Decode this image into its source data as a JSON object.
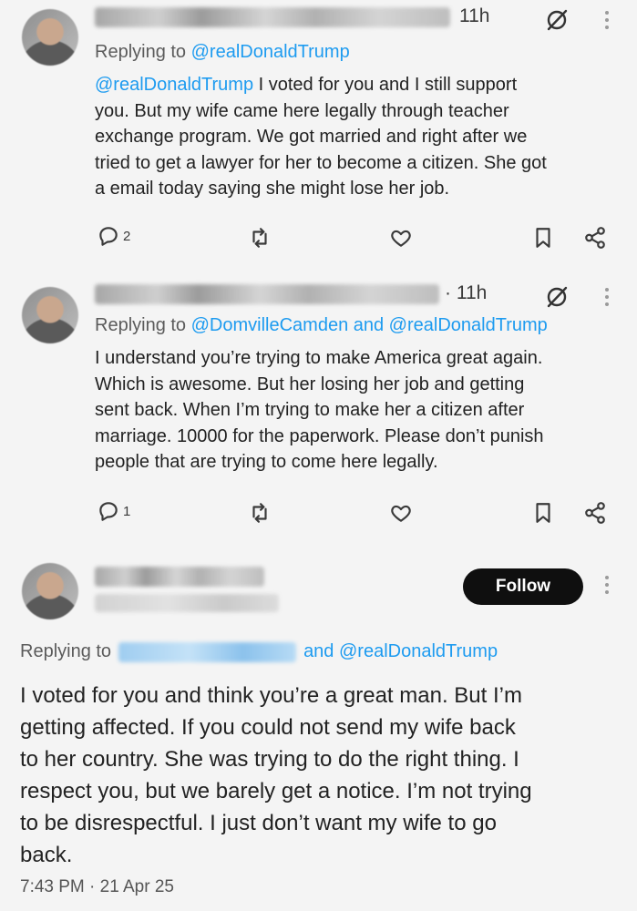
{
  "tweets": [
    {
      "time": "11h",
      "reply_prefix": "Replying to",
      "reply_mentions": "@realDonaldTrump",
      "body_mention": "@realDonaldTrump",
      "lines": [
        " I voted for you and I still support",
        "you. But my wife came here legally through teacher",
        "exchange program. We got married and right after we",
        "tried to get a lawyer for her to become a citizen. She got",
        "a email today saying she might lose her job."
      ],
      "reply_count": "2"
    },
    {
      "time": "· 11h",
      "reply_prefix": "Replying to",
      "reply_mentions": "@DomvilleCamden and @realDonaldTrump",
      "lines": [
        "I understand you’re trying to make America great again.",
        "Which is awesome. But her losing her job and getting",
        "sent back. When I’m trying to make her a citizen after",
        "marriage. 10000 for the paperwork. Please don’t punish",
        "people that are trying to come here legally."
      ],
      "reply_count": "1"
    }
  ],
  "main_tweet": {
    "follow_label": "Follow",
    "reply_prefix": "Replying to",
    "reply_suffix": "and @realDonaldTrump",
    "lines": [
      "I voted for you and think you’re a great man. But I’m",
      "getting affected. If you could not send my wife back",
      "to her country. She was trying to do the right thing. I",
      "respect you, but we barely get a notice. I’m not trying",
      "to be disrespectful. I just don’t want my wife to go",
      "back."
    ],
    "timestamp": "7:43 PM · 21 Apr 25"
  },
  "icons": {
    "reply": "reply-icon",
    "retweet": "retweet-icon",
    "like": "heart-icon",
    "bookmark": "bookmark-icon",
    "share": "share-icon",
    "grok": "grok-icon",
    "more": "more-options-icon"
  },
  "colors": {
    "accent": "#1d9bf0",
    "follow_bg": "#0f0f0f",
    "background": "#f4f4f4"
  }
}
